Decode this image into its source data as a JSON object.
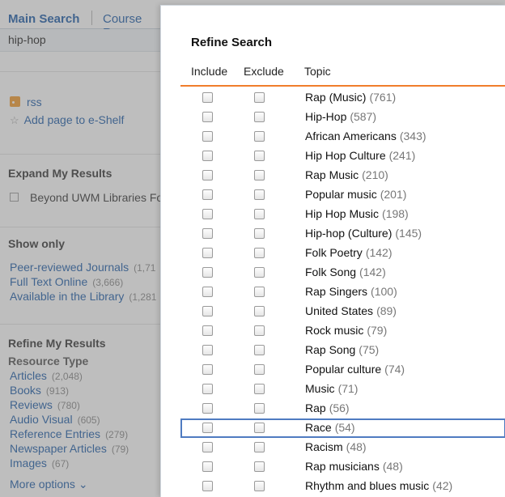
{
  "background": {
    "tabs": {
      "main": "Main Search",
      "course": "Course Res"
    },
    "search_value": "hip-hop",
    "links": {
      "rss": "rss",
      "eshelf": "Add page to e-Shelf"
    },
    "expand": {
      "title": "Expand My Results",
      "option": "Beyond UWM Libraries Fo"
    },
    "show_only": {
      "title": "Show only",
      "items": [
        {
          "label": "Peer-reviewed Journals",
          "count": "(1,71"
        },
        {
          "label": "Full Text Online",
          "count": "(3,666)"
        },
        {
          "label": "Available in the Library",
          "count": "(1,281"
        }
      ]
    },
    "refine_my_results": {
      "title": "Refine My Results",
      "resource_type_title": "Resource Type",
      "items": [
        {
          "label": "Articles",
          "count": "(2,048)"
        },
        {
          "label": "Books",
          "count": "(913)"
        },
        {
          "label": "Reviews",
          "count": "(780)"
        },
        {
          "label": "Audio Visual",
          "count": "(605)"
        },
        {
          "label": "Reference Entries",
          "count": "(279)"
        },
        {
          "label": "Newspaper Articles",
          "count": "(79)"
        },
        {
          "label": "Images",
          "count": "(67)"
        }
      ],
      "more_options": "More options ⌄"
    }
  },
  "modal": {
    "title": "Refine Search",
    "columns": {
      "include": "Include",
      "exclude": "Exclude",
      "topic": "Topic"
    },
    "rows": [
      {
        "topic": "Rap (Music)",
        "count": "(761)"
      },
      {
        "topic": "Hip-Hop",
        "count": "(587)"
      },
      {
        "topic": "African Americans",
        "count": "(343)"
      },
      {
        "topic": "Hip Hop Culture",
        "count": "(241)"
      },
      {
        "topic": "Rap Music",
        "count": "(210)"
      },
      {
        "topic": "Popular music",
        "count": "(201)"
      },
      {
        "topic": "Hip Hop Music",
        "count": "(198)"
      },
      {
        "topic": "Hip-hop (Culture)",
        "count": "(145)"
      },
      {
        "topic": "Folk Poetry",
        "count": "(142)"
      },
      {
        "topic": "Folk Song",
        "count": "(142)"
      },
      {
        "topic": "Rap Singers",
        "count": "(100)"
      },
      {
        "topic": "United States",
        "count": "(89)"
      },
      {
        "topic": "Rock music",
        "count": "(79)"
      },
      {
        "topic": "Rap Song",
        "count": "(75)"
      },
      {
        "topic": "Popular culture",
        "count": "(74)"
      },
      {
        "topic": "Music",
        "count": "(71)"
      },
      {
        "topic": "Rap",
        "count": "(56)"
      },
      {
        "topic": "Race",
        "count": "(54)",
        "highlighted": true
      },
      {
        "topic": "Racism",
        "count": "(48)"
      },
      {
        "topic": "Rap musicians",
        "count": "(48)"
      },
      {
        "topic": "Rhythm and blues music",
        "count": "(42)"
      }
    ]
  },
  "colors": {
    "link": "#1d5ca8",
    "accent_rule": "#f07d2b",
    "highlight": "#4f7bc1"
  }
}
